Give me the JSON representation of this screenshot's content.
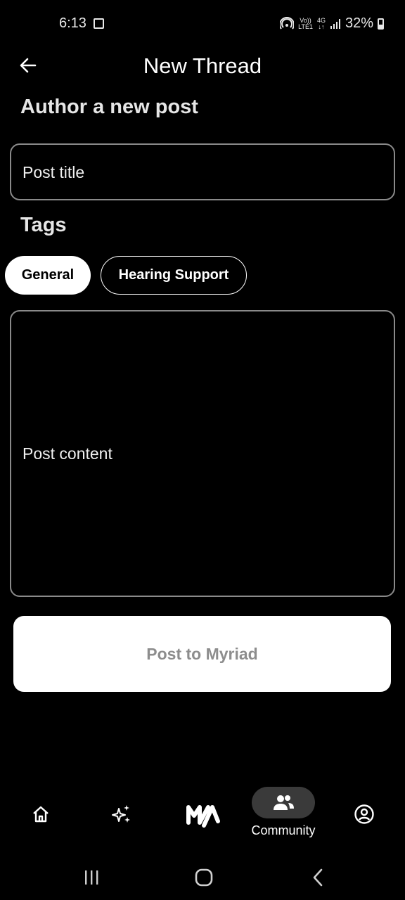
{
  "status_bar": {
    "time": "6:13",
    "network_top": "Vo))",
    "network_bottom": "LTE1",
    "data_top": "4G",
    "data_bottom": "↓↑",
    "battery": "32%"
  },
  "header": {
    "title": "New Thread"
  },
  "form": {
    "heading": "Author a new post",
    "title_placeholder": "Post title",
    "tags_heading": "Tags",
    "tags": [
      {
        "label": "General",
        "selected": true
      },
      {
        "label": "Hearing Support",
        "selected": false
      }
    ],
    "content_placeholder": "Post content",
    "submit_label": "Post to Myriad"
  },
  "bottom_nav": {
    "items": [
      {
        "icon": "home-icon"
      },
      {
        "icon": "sparkles-icon"
      },
      {
        "icon": "myriad-logo-icon"
      },
      {
        "icon": "community-icon",
        "label": "Community",
        "active": true
      },
      {
        "icon": "profile-icon"
      }
    ]
  },
  "system_nav": {
    "items": [
      "recents-icon",
      "home-circle-icon",
      "back-chevron-icon"
    ]
  }
}
